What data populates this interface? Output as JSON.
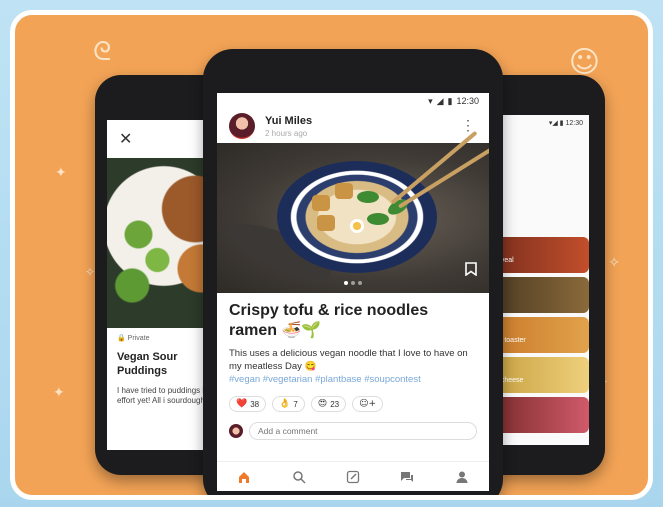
{
  "status_bar": {
    "time": "12:30"
  },
  "post": {
    "author": "Yui Miles",
    "time": "2 hours ago",
    "title": "Crispy tofu & rice noodles ramen 🍜🌱",
    "description": "This uses a delicious vegan noodle that I love to have on my meatless Day 😋",
    "hashtags": "#vegan #vegetarian #plantbase #soupcontest",
    "reactions": [
      {
        "emoji": "❤️",
        "count": "38"
      },
      {
        "emoji": "👌",
        "count": "7"
      },
      {
        "emoji": "😍",
        "count": "23"
      }
    ],
    "comment_placeholder": "Add a comment"
  },
  "left_phone": {
    "badge": "Private",
    "title": "Vegan Sour Puddings",
    "body": "I have tried to puddings befo effort yet! All i sourdough pe"
  },
  "right_phone": {
    "status_time": "12:30",
    "tiles": [
      "d veal",
      "",
      "ch toaster",
      "d cheese",
      ""
    ]
  },
  "icons": {
    "close": "close-icon",
    "more": "more-vert-icon",
    "bookmark": "bookmark-icon",
    "home": "home-icon",
    "search": "search-icon",
    "edit": "edit-icon",
    "chat": "chat-icon",
    "profile": "profile-icon"
  },
  "colors": {
    "accent": "#f07a2a",
    "background": "#f2a356",
    "hashtag": "#7aa8d8"
  }
}
